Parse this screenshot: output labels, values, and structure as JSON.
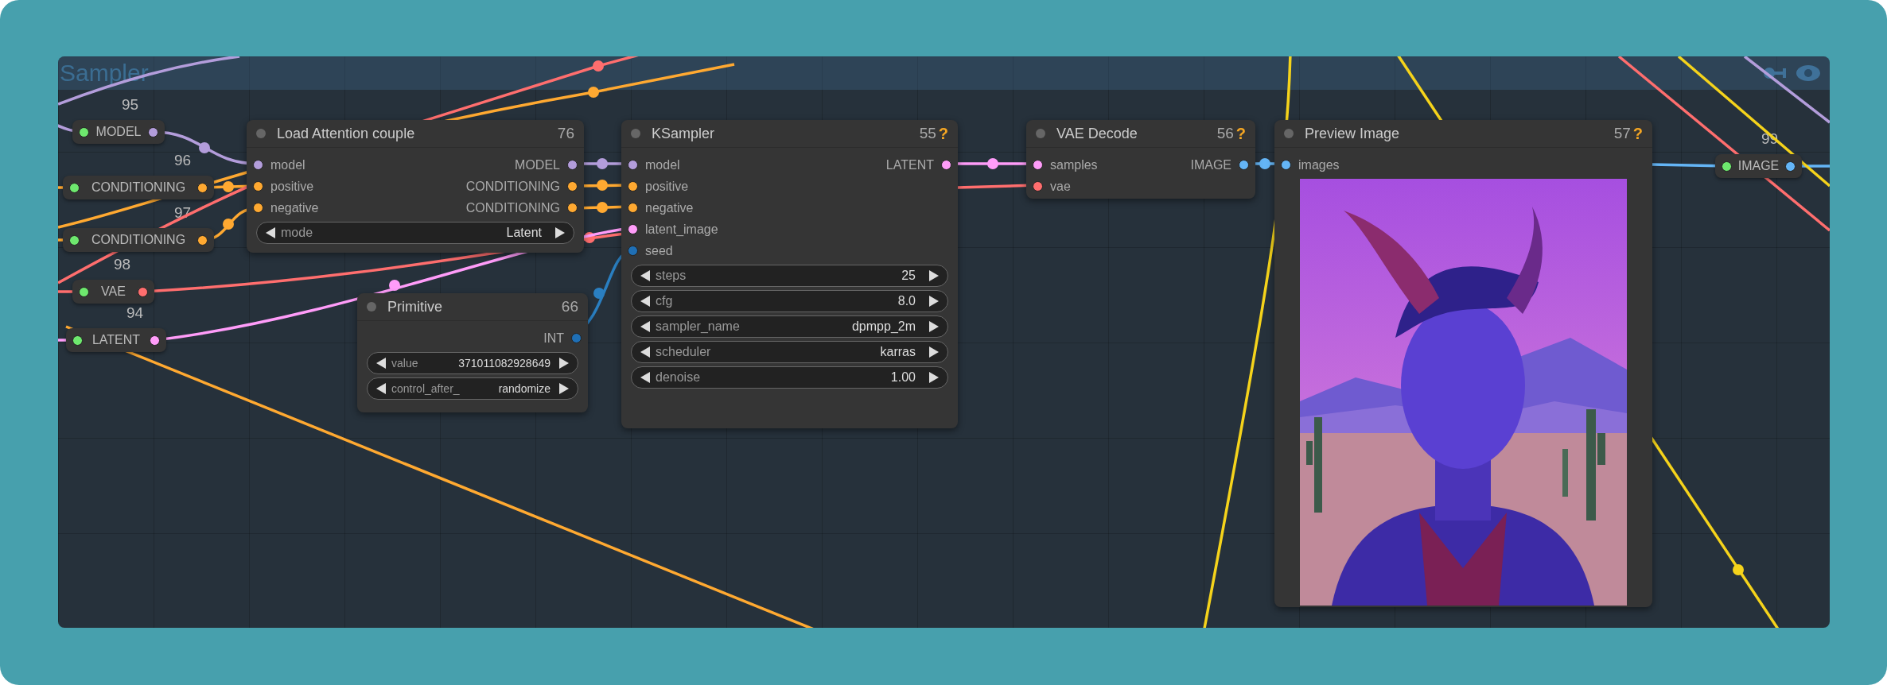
{
  "group": {
    "title": "Sampler"
  },
  "reroutes": [
    {
      "id": "95",
      "type": "MODEL",
      "color": "#b39ddb"
    },
    {
      "id": "96",
      "type": "CONDITIONING",
      "color": "#ffa931"
    },
    {
      "id": "97",
      "type": "CONDITIONING",
      "color": "#ffa931"
    },
    {
      "id": "98",
      "type": "VAE",
      "color": "#ff6e6e"
    },
    {
      "id": "94",
      "type": "LATENT",
      "color": "#ff9cf9"
    },
    {
      "id": "99",
      "type": "IMAGE",
      "color": "#64b5f6"
    }
  ],
  "nodes": [
    {
      "id": "76",
      "title": "Load Attention couple",
      "inputs": [
        {
          "name": "model",
          "color": "#b39ddb"
        },
        {
          "name": "positive",
          "color": "#ffa931"
        },
        {
          "name": "negative",
          "color": "#ffa931"
        }
      ],
      "outputs": [
        {
          "name": "MODEL",
          "color": "#b39ddb"
        },
        {
          "name": "CONDITIONING",
          "color": "#ffa931"
        },
        {
          "name": "CONDITIONING",
          "color": "#ffa931"
        }
      ],
      "widgets": [
        {
          "label": "mode",
          "value": "Latent"
        }
      ]
    },
    {
      "id": "66",
      "title": "Primitive",
      "outputs": [
        {
          "name": "INT",
          "color": "#1f6fb5"
        }
      ],
      "widgets": [
        {
          "label": "value",
          "value": "371011082928649"
        },
        {
          "label": "control_after_",
          "value": "randomize"
        }
      ]
    },
    {
      "id": "55",
      "badge": "?",
      "title": "KSampler",
      "inputs": [
        {
          "name": "model",
          "color": "#b39ddb"
        },
        {
          "name": "positive",
          "color": "#ffa931"
        },
        {
          "name": "negative",
          "color": "#ffa931"
        },
        {
          "name": "latent_image",
          "color": "#ff9cf9"
        },
        {
          "name": "seed",
          "color": "#1f6fb5"
        }
      ],
      "outputs": [
        {
          "name": "LATENT",
          "color": "#ff9cf9"
        }
      ],
      "widgets": [
        {
          "label": "steps",
          "value": "25"
        },
        {
          "label": "cfg",
          "value": "8.0"
        },
        {
          "label": "sampler_name",
          "value": "dpmpp_2m"
        },
        {
          "label": "scheduler",
          "value": "karras"
        },
        {
          "label": "denoise",
          "value": "1.00"
        }
      ]
    },
    {
      "id": "56",
      "badge": "?",
      "title": "VAE Decode",
      "inputs": [
        {
          "name": "samples",
          "color": "#ff9cf9"
        },
        {
          "name": "vae",
          "color": "#ff6e6e"
        }
      ],
      "outputs": [
        {
          "name": "IMAGE",
          "color": "#64b5f6"
        }
      ]
    },
    {
      "id": "57",
      "badge": "?",
      "title": "Preview Image",
      "inputs": [
        {
          "name": "images",
          "color": "#64b5f6"
        }
      ],
      "image": {
        "kind": "picture"
      }
    }
  ]
}
